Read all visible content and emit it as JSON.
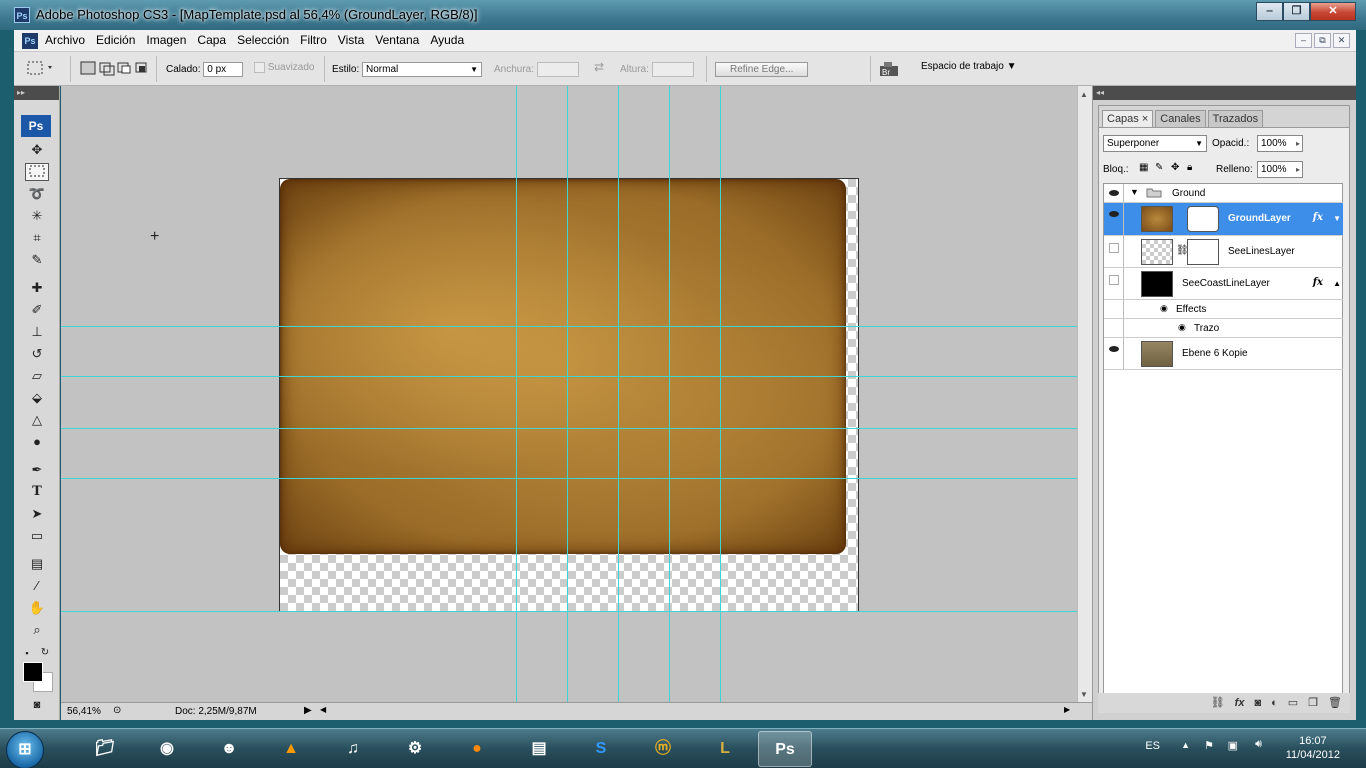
{
  "window": {
    "title": "Adobe Photoshop CS3 - [MapTemplate.psd al 56,4% (GroundLayer, RGB/8)]",
    "ps_badge": "Ps",
    "controls": [
      "‒",
      "❐",
      "✕"
    ]
  },
  "menubar": {
    "logo": "Ps",
    "items": [
      "Archivo",
      "Edición",
      "Imagen",
      "Capa",
      "Selección",
      "Filtro",
      "Vista",
      "Ventana",
      "Ayuda"
    ],
    "mdi": [
      "–",
      "⧉",
      "✕"
    ]
  },
  "options": {
    "calado_label": "Calado:",
    "calado_value": "0 px",
    "suavizado_label": "Suavizado",
    "estilo_label": "Estilo:",
    "estilo_value": "Normal",
    "anchura_label": "Anchura:",
    "altura_label": "Altura:",
    "refine_label": "Refine Edge...",
    "workspace_label": "Espacio de trabajo"
  },
  "toolbox": {
    "logo": "Ps",
    "tools": [
      "move-tool",
      "marquee-tool",
      "lasso-tool",
      "magic-wand-tool",
      "crop-tool",
      "slice-tool",
      "healing-tool",
      "brush-tool",
      "stamp-tool",
      "history-brush-tool",
      "eraser-tool",
      "paint-bucket-tool",
      "blur-tool",
      "dodge-tool",
      "pen-tool",
      "type-tool",
      "path-select-tool",
      "shape-tool",
      "notes-tool",
      "eyedropper-tool",
      "hand-tool",
      "zoom-tool"
    ]
  },
  "status": {
    "zoom": "56,41%",
    "doc": "Doc: 2,25M/9,87M"
  },
  "layers_panel": {
    "tabs": [
      "Capas",
      "Canales",
      "Trazados"
    ],
    "blend_mode": "Superponer",
    "opacity_label": "Opacid.:",
    "opacity_value": "100%",
    "lock_label": "Bloq.:",
    "fill_label": "Relleno:",
    "fill_value": "100%",
    "layers": [
      {
        "name": "Ground",
        "type": "group",
        "visible": true
      },
      {
        "name": "GroundLayer",
        "selected": true,
        "visible": true,
        "fx": "fx"
      },
      {
        "name": "SeeLinesLayer",
        "visible": false
      },
      {
        "name": "SeeCoastLineLayer",
        "visible": false,
        "fx": "fx"
      },
      {
        "name": "Effects",
        "type": "effects-header"
      },
      {
        "name": "Trazo",
        "type": "effect"
      },
      {
        "name": "Ebene 6 Kopie",
        "visible": true
      }
    ]
  },
  "taskbar": {
    "language": "ES",
    "time": "16:07",
    "date": "11/04/2012",
    "apps": [
      "explorer",
      "chrome",
      "avatar",
      "vlc",
      "itunes",
      "steam",
      "firefox",
      "notepad",
      "skype",
      "game",
      "league",
      "photoshop"
    ],
    "active_app": "Ps"
  },
  "colors": {
    "guide": "#3fd5d5",
    "selection": "#3d8ee8"
  }
}
